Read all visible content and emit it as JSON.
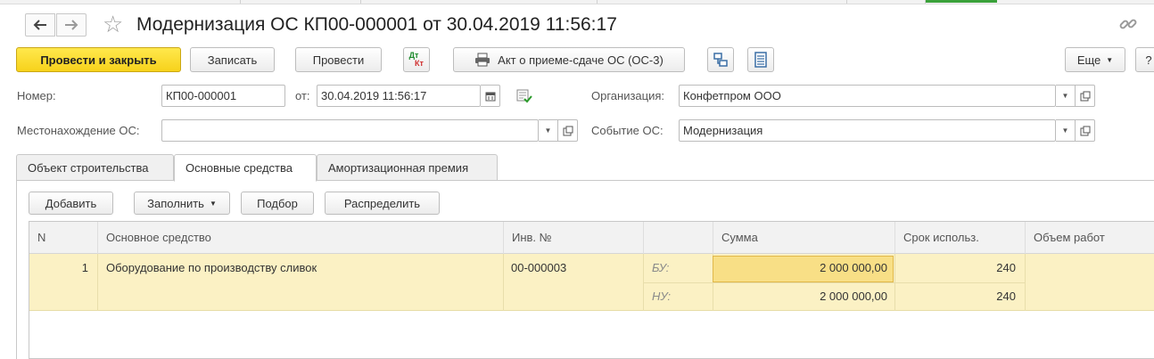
{
  "window": {
    "title": "Модернизация ОС КП00-000001 от 30.04.2019 11:56:17",
    "back_icon": "arrow-left-icon",
    "forward_icon": "arrow-right-icon",
    "favorite_icon": "star-icon",
    "link_icon": "link-icon"
  },
  "toolbar": {
    "post_close_label": "Провести и закрыть",
    "save_label": "Записать",
    "post_label": "Провести",
    "dtkt_top": "Дт",
    "dtkt_bottom": "Кт",
    "print_label": "Акт о приеме-сдаче ОС (ОС-3)",
    "more_label": "Еще",
    "help_label": "?"
  },
  "form": {
    "number_label": "Номер:",
    "number_value": "КП00-000001",
    "date_label": "от:",
    "date_value": "30.04.2019 11:56:17",
    "org_label": "Организация:",
    "org_value": "Конфетпром ООО",
    "location_label": "Местонахождение ОС:",
    "location_value": "",
    "event_label": "Событие ОС:",
    "event_value": "Модернизация"
  },
  "tabs": [
    {
      "label": "Объект строительства",
      "active": false
    },
    {
      "label": "Основные средства",
      "active": true
    },
    {
      "label": "Амортизационная премия",
      "active": false
    }
  ],
  "table_toolbar": {
    "add_label": "Добавить",
    "fill_label": "Заполнить",
    "select_label": "Подбор",
    "distribute_label": "Распределить"
  },
  "table": {
    "columns": [
      "N",
      "Основное средство",
      "Инв. №",
      "",
      "Сумма",
      "Срок использ.",
      "Объем работ"
    ],
    "rows": [
      {
        "n": "1",
        "asset": "Оборудование по производству сливок",
        "inv": "00-000003",
        "bu_label": "БУ:",
        "bu_sum": "2 000 000,00",
        "bu_term": "240",
        "nu_label": "НУ:",
        "nu_sum": "2 000 000,00",
        "nu_term": "240"
      }
    ]
  },
  "colors": {
    "primary_button": "#f7d21b",
    "selected_row": "#fbf1c4",
    "selected_cell": "#f8df86"
  }
}
